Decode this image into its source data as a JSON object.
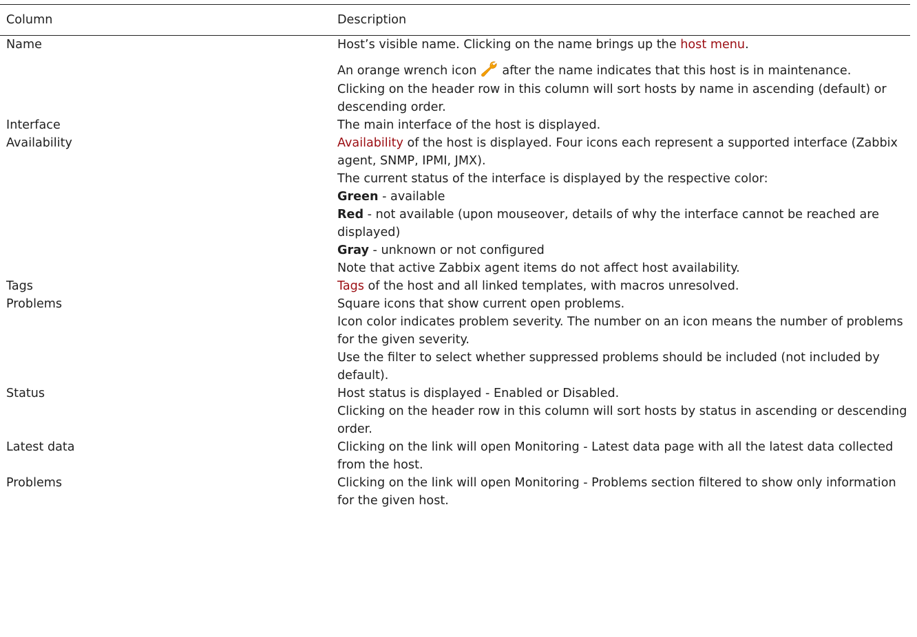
{
  "header": {
    "col1": "Column",
    "col2": "Description"
  },
  "rows": {
    "name": {
      "label": "Name",
      "p1_pre": "Host’s visible name. Clicking on the name brings up the ",
      "p1_link": "host menu",
      "p1_post": ".",
      "p2_pre": "An orange wrench icon",
      "p2_icon": "wrench-icon",
      "p2_post": "after the name indicates that this host is in maintenance.",
      "p3": "Clicking on the header row in this column will sort hosts by name in ascending (default) or descending order."
    },
    "interface": {
      "label": "Interface",
      "p1": "The main interface of the host is displayed."
    },
    "availability": {
      "label": "Availability",
      "p1_link": "Availability",
      "p1_post": " of the host is displayed. Four icons each represent a supported interface (Zabbix agent, SNMP, IPMI, JMX).",
      "p2": "The current status of the interface is displayed by the respective color:",
      "green_bold": "Green",
      "green_text": " - available",
      "red_bold": "Red",
      "red_text": " - not available (upon mouseover, details of why the interface cannot be reached are displayed)",
      "gray_bold": "Gray",
      "gray_text": " - unknown or not configured",
      "p3": "Note that active Zabbix agent items do not affect host availability."
    },
    "tags": {
      "label": "Tags",
      "p1_link": "Tags",
      "p1_post": " of the host and all linked templates, with macros unresolved."
    },
    "problems": {
      "label": "Problems",
      "p1": "Square icons that show current open problems.",
      "p2": "Icon color indicates problem severity. The number on an icon means the number of problems for the given severity.",
      "p3": "Use the filter to select whether suppressed problems should be included (not included by default)."
    },
    "status": {
      "label": "Status",
      "p1": "Host status is displayed - Enabled or Disabled.",
      "p2": "Clicking on the header row in this column will sort hosts by status in ascending or descending order."
    },
    "latest_data": {
      "label": "Latest data",
      "p1": "Clicking on the link will open Monitoring - Latest data page with all the latest data collected from the host."
    },
    "problems_link": {
      "label": "Problems",
      "p1": "Clicking on the link will open Monitoring - Problems section filtered to show only information for the given host."
    }
  },
  "colors": {
    "link": "#9b0d12",
    "text": "#1f1f1f",
    "wrench": "#f5a100"
  }
}
